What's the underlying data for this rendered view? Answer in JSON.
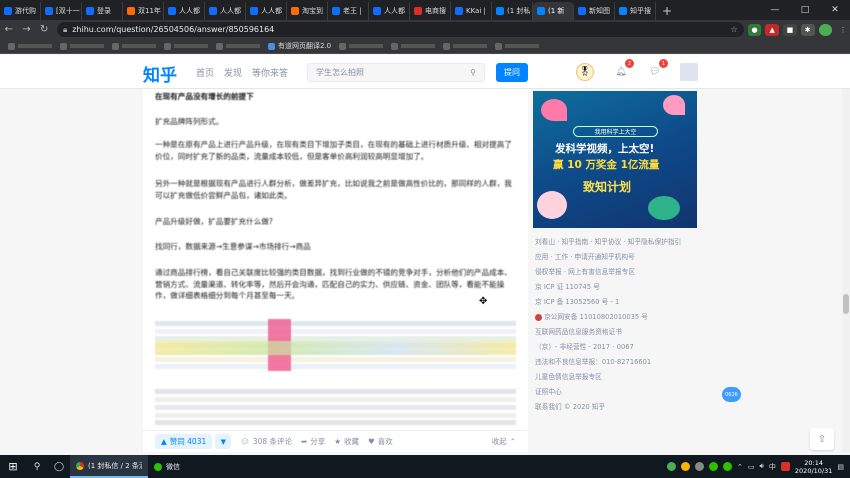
{
  "browser": {
    "tabs": [
      {
        "label": "游代购",
        "fav": "blue"
      },
      {
        "label": "[双十一",
        "fav": "blue"
      },
      {
        "label": "登录",
        "fav": "blue"
      },
      {
        "label": "双11年",
        "fav": "orange"
      },
      {
        "label": "人人都",
        "fav": "blue"
      },
      {
        "label": "人人都",
        "fav": "blue"
      },
      {
        "label": "人人都",
        "fav": "blue"
      },
      {
        "label": "淘宝到",
        "fav": "orange"
      },
      {
        "label": "老王 |",
        "fav": "blue"
      },
      {
        "label": "人人都",
        "fav": "blue"
      },
      {
        "label": "电商搜",
        "fav": "red"
      },
      {
        "label": "KKai |",
        "fav": "blue"
      },
      {
        "label": "(1 封私",
        "fav": "zh"
      },
      {
        "label": "(1 新",
        "fav": "zh",
        "active": true
      },
      {
        "label": "新知图",
        "fav": "blue"
      },
      {
        "label": "知乎搜",
        "fav": "zh"
      }
    ],
    "new_tab": "+",
    "window_controls": [
      "—",
      "□",
      "✕"
    ],
    "url": "zhihu.com/question/26504506/answer/850596164",
    "bookmarks": [
      {
        "label": "",
        "blur": true
      },
      {
        "label": "",
        "blur": true
      },
      {
        "label": "",
        "blur": true
      },
      {
        "label": "",
        "blur": true
      },
      {
        "label": "",
        "blur": true
      },
      {
        "label": "有道网页翻译2.0",
        "blur": false
      },
      {
        "label": "",
        "blur": true
      },
      {
        "label": "",
        "blur": true
      },
      {
        "label": "",
        "blur": true
      },
      {
        "label": "",
        "blur": true
      }
    ]
  },
  "zhihu": {
    "logo": "知乎",
    "nav": [
      "首页",
      "发现",
      "等你来答"
    ],
    "search_placeholder": "学生怎么拍照",
    "ask_button": "提问",
    "notif_badge": "2",
    "msg_badge": "1"
  },
  "article": {
    "paragraphs": [
      {
        "text": "在现有产品没有增长的前提下",
        "bold": true
      },
      {
        "text": "扩充品牌阵列形式。",
        "bold": false
      },
      {
        "text": "一种是在原有产品上进行产品升级，在现有类目下增加子类目，在现有的基础上进行材质升级、相对提高了价位，同时扩充了新的品类，流量成本较低，但是客单价高利润较高明显增加了。",
        "bold": false
      },
      {
        "text": "另外一种就是根据现有产品进行人群分析，做差异扩充，比如说我之前是做高性价比的，那同样的人群，我可以扩充做低价尝鲜产品包，诸如此类。",
        "bold": false
      },
      {
        "text": "产品升级好做，扩品要扩充什么做?",
        "bold": false
      },
      {
        "text": "找同行，数据来源→生意参谋→市场排行→商品",
        "bold": false
      },
      {
        "text": "通过商品排行榜，看自己关联度比较强的类目数据，找到行业做的不错的竞争对手，分析他们的产品成本、营销方式、流量渠道、转化率等，然后开会沟通，匹配自己的实力、供应链、资金、团队等，看能不能操作，做详细表格细分到每个月甚至每一天。",
        "bold": false
      }
    ],
    "vote_label": "赞同 4031",
    "comments": "308 条评论",
    "share": "分享",
    "favorite": "收藏",
    "like": "喜欢",
    "collapse": "收起"
  },
  "sidebar": {
    "banner_top": "我用科学上大空",
    "banner_line1": "发科学视频，上太空!",
    "banner_line2": "赢 10 万奖金 1亿流量",
    "banner_line3": "致知计划",
    "links": [
      "刘看山 · 知乎指南 · 知乎协议 · 知乎隐私保护指引",
      "应用 · 工作 · 申请开通知乎机构号",
      "侵权举报 · 网上有害信息举报专区",
      "京 ICP 证 110745 号",
      "京 ICP 备 13052560 号 - 1",
      "京公网安备 11010802010035 号",
      "互联网药品信息服务资格证书",
      "（京）- 非经营性 - 2017 - 0067",
      "违法和不良信息举报：010-82716601",
      "儿童色情信息举报专区",
      "证照中心",
      "联系我们 © 2020 知乎"
    ],
    "float_pill": "0626"
  },
  "taskbar": {
    "apps": [
      "(1 封私信 / 2 条消...",
      "微信"
    ],
    "lang": "中",
    "time": "20:14",
    "date": "2020/10/31"
  },
  "colors": {
    "zhihu_blue": "#0084ff",
    "chrome_dark": "#202124",
    "taskbar": "#101820"
  }
}
